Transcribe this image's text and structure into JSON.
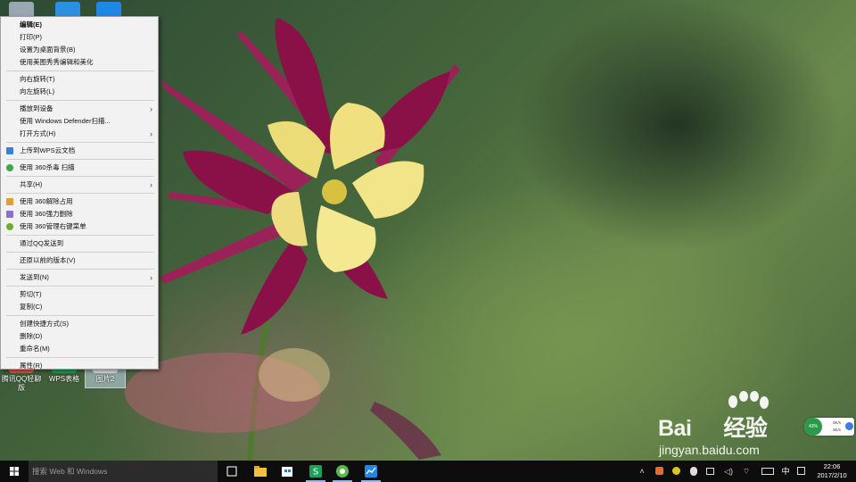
{
  "desktop": {
    "icons": [
      {
        "label": ""
      },
      {
        "label": ""
      },
      {
        "label": ""
      },
      {
        "label": "腾讯QQ轻聊版"
      },
      {
        "label": "WPS表格"
      },
      {
        "label": "图片2"
      }
    ]
  },
  "context_menu": {
    "items": [
      {
        "label": "编辑(E)",
        "bold": true
      },
      {
        "label": "打印(P)"
      },
      {
        "label": "设置为桌面背景(B)"
      },
      {
        "label": "使用美图秀秀编辑和美化"
      },
      {
        "label": "向右旋转(T)"
      },
      {
        "label": "向左旋转(L)"
      },
      {
        "label": "播放到设备",
        "submenu": true
      },
      {
        "label": "使用 Windows Defender扫描..."
      },
      {
        "label": "打开方式(H)",
        "submenu": true
      },
      {
        "label": "上传到WPS云文档",
        "icon": "wps-cloud-icon"
      },
      {
        "label": "使用 360杀毒 扫描",
        "icon": "360-antivirus-icon"
      },
      {
        "label": "共享(H)",
        "submenu": true
      },
      {
        "label": "使用 360解除占用",
        "icon": "360-unlock-icon"
      },
      {
        "label": "使用 360强力删除",
        "icon": "360-delete-icon"
      },
      {
        "label": "使用 360管理右键菜单",
        "icon": "360-menu-icon"
      },
      {
        "label": "通过QQ发送到"
      },
      {
        "label": "还原以前的版本(V)"
      },
      {
        "label": "发送到(N)",
        "submenu": true
      },
      {
        "label": "剪切(T)"
      },
      {
        "label": "复制(C)"
      },
      {
        "label": "创建快捷方式(S)"
      },
      {
        "label": "删除(D)"
      },
      {
        "label": "重命名(M)"
      },
      {
        "label": "属性(R)"
      }
    ]
  },
  "taskbar": {
    "search_placeholder": "搜索 Web 和 Windows",
    "ime_label": "中",
    "clock_time": "22:06",
    "clock_date": "2017/2/10"
  },
  "speed_widget": {
    "percent": "43%",
    "up": "0K/s",
    "down": "0K/s"
  },
  "watermark": {
    "brand": "Bai",
    "brand2": "经验",
    "url": "jingyan.baidu.com"
  },
  "colors": {
    "menu_bg": "#f2f2f2",
    "taskbar_bg": "#0d0d0d",
    "accent": "#8fb8e8"
  }
}
